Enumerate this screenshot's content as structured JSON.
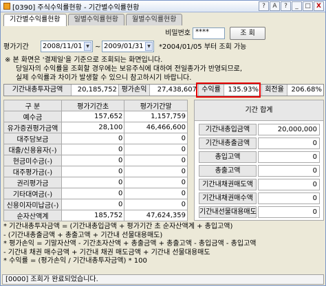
{
  "window": {
    "title": "[0390] 주식수익률현황 - 기간별수익률현황",
    "buttons": [
      "?",
      "A",
      "?",
      "_",
      "□",
      "X"
    ]
  },
  "tabs": [
    {
      "label": "기간별수익률현황",
      "active": true
    },
    {
      "label": "일별수익률현황",
      "active": false
    },
    {
      "label": "월별수익률현황",
      "active": false
    }
  ],
  "auth": {
    "password_label": "비밀번호",
    "password_value": "****",
    "query_button": "조 회"
  },
  "period": {
    "label": "평가기간",
    "start": "2008/11/01",
    "tilde": "~",
    "end": "2009/01/31",
    "note": "*2004/01/05 부터 조회 가능"
  },
  "notice": [
    "※ 본 화면은 '결제일'을 기준으로 조회되는 화면입니다.",
    "당일자의 수익률을 조회할 경우에는 보유주식에 대하여 전일종가가 반영되므로,",
    "실제 수익률과 차이가 발생할 수 있으니 참고하시기 바랍니다."
  ],
  "summary": {
    "invest_label": "기간내총투자금액",
    "invest_value": "20,185,752",
    "profit_label": "평가손익",
    "profit_value": "27,438,607",
    "return_label": "수익률",
    "return_value": "135.93%",
    "turnover_label": "회전율",
    "turnover_value": "206.68%"
  },
  "left_table": {
    "headers": [
      "구 분",
      "평가기간초",
      "평가기간말"
    ],
    "rows": [
      {
        "name": "예수금",
        "start": "157,652",
        "end": "1,157,759"
      },
      {
        "name": "유가증권평가금액",
        "start": "28,100",
        "end": "46,466,600"
      },
      {
        "name": "대주담보금",
        "start": "0",
        "end": "0"
      },
      {
        "name": "대출/신용융자(-)",
        "start": "0",
        "end": "0"
      },
      {
        "name": "현금미수금(-)",
        "start": "0",
        "end": "0"
      },
      {
        "name": "대주평가금(-)",
        "start": "0",
        "end": "0"
      },
      {
        "name": "권리평가금",
        "start": "0",
        "end": "0"
      },
      {
        "name": "기타대여금(-)",
        "start": "0",
        "end": "0"
      },
      {
        "name": "신용이자미납금(-)",
        "start": "0",
        "end": "0"
      },
      {
        "name": "순자산액계",
        "start": "185,752",
        "end": "47,624,359"
      }
    ]
  },
  "right_table": {
    "header": "기간 합계",
    "rows": [
      {
        "name": "기간내총입금액",
        "value": "20,000,000"
      },
      {
        "name": "기간내총출금액",
        "value": "0"
      },
      {
        "name": "총입고액",
        "value": "0"
      },
      {
        "name": "총출고액",
        "value": "0"
      },
      {
        "name": "기간내채권매도액",
        "value": "0"
      },
      {
        "name": "기간내채권매수액",
        "value": "0"
      },
      {
        "name": "기간내선물대용매도",
        "value": "0"
      }
    ]
  },
  "formulas": [
    "* 기간내총투자금액 = (기간내총입금액 + 평가기간 초 순자산액계 + 총입고액)",
    "         - (기간내총출금액 + 총출고액 + 기간내 선물대용매도)",
    "* 평가손익 = 기말자산액 - 기간초자산액 + 총출금액 + 총출고액 - 총입금액 - 총입고액",
    "         - 기간내 채권 매수금액 + 기간내 채권 매도금액 + 기간내 선물대용매도",
    "* 수익률 = (평가손익 / 기간내총투자금액) * 100"
  ],
  "status": "[0000] 조회가 완료되었습니다.",
  "colors": {
    "highlight": "#e60000",
    "label_bg": "#e7e7e7",
    "window_bg": "#ece9d8"
  }
}
